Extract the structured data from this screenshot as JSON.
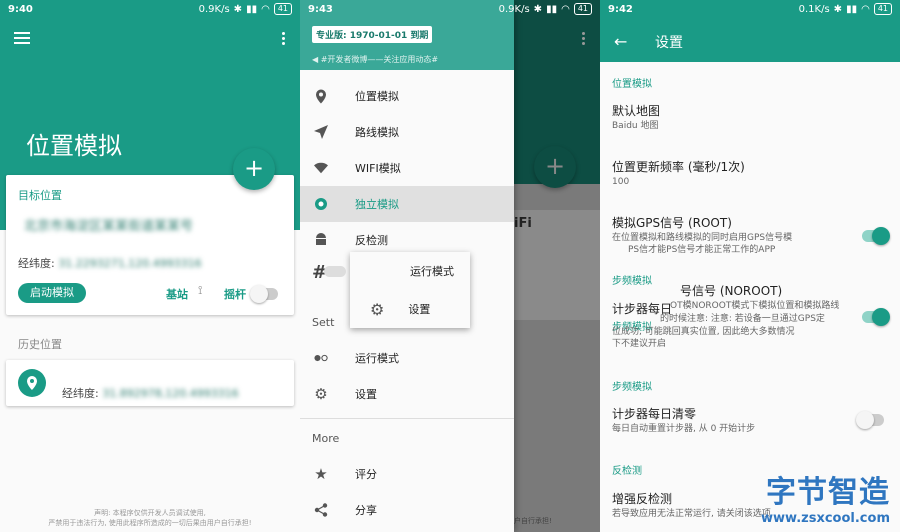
{
  "screen1": {
    "status": {
      "time": "9:40",
      "net": "0.9K/s",
      "battery": "41"
    },
    "title": "位置模拟",
    "fab": "+",
    "target_card": {
      "label": "目标位置",
      "address_blurred": "北京市海淀区某某街道某某号",
      "coords_label": "经纬度:",
      "coords_blurred": "31.2293271,120.4993316",
      "start_button": "启动模拟",
      "base_station": "基站",
      "joystick": "摇杆"
    },
    "history_label": "历史位置",
    "history_card": {
      "coords_label": "经纬度:",
      "coords_blurred": "31.892978,120.4993316"
    },
    "disclaimer_line1": "声明: 本程序仅供开发人员调试使用,",
    "disclaimer_line2": "严禁用于违法行为, 使用此程序所造成的一切后果由用户自行承担!"
  },
  "screen2": {
    "status": {
      "time": "9:43",
      "net": "0.9K/s",
      "battery": "41"
    },
    "pro_badge": "专业版: 1970-01-01 到期",
    "notice": "#开发者微博——关注应用动态#",
    "menu": [
      {
        "label": "位置模拟",
        "icon": "location-pin-icon"
      },
      {
        "label": "路线模拟",
        "icon": "navigation-arrow-icon"
      },
      {
        "label": "WIFI模拟",
        "icon": "wifi-icon"
      },
      {
        "label": "独立模拟",
        "icon": "target-icon"
      },
      {
        "label": "反检测",
        "icon": "android-icon"
      }
    ],
    "hash_text": "#",
    "settings_section": "Sett",
    "settings_items": [
      {
        "label": "运行模式",
        "icon": "toggle-icon"
      },
      {
        "label": "设置",
        "icon": "gear-icon"
      }
    ],
    "popup_items": [
      {
        "label": "运行模式"
      },
      {
        "label": "设置"
      }
    ],
    "more_section": "More",
    "more_items": [
      {
        "label": "评分",
        "icon": "star-icon"
      },
      {
        "label": "分享",
        "icon": "share-icon"
      }
    ],
    "bg_wifi_text": "iFi",
    "bg_footer": "户自行承担!"
  },
  "screen3": {
    "status": {
      "time": "9:42",
      "net": "0.1K/s",
      "battery": "41"
    },
    "title": "设置",
    "sections": {
      "location": "位置模拟",
      "step1": "步频模拟",
      "step2": "步频模拟",
      "step3": "步频模拟",
      "anti": "反检测"
    },
    "prefs": {
      "default_map_title": "默认地图",
      "default_map_value": "Baidu 地图",
      "update_rate_title": "位置更新频率 (毫秒/1次)",
      "update_rate_value": "100",
      "gps_root_title": "模拟GPS信号 (ROOT)",
      "gps_root_sum1": "在位置模拟和路线模拟的同时启用GPS信号模",
      "gps_root_sum2": "PS信才能PS信号才能正常工作的APP",
      "noroot_title": "号信号 (NOROOT)",
      "noroot_title_overlap": "计步器每日",
      "noroot_sum1": "OT模NOROOT模式下模拟位置和模拟路线",
      "noroot_sum2": "的时候注意: 注意: 若设备一旦通过GPS定",
      "noroot_sum3": "位成功, 可能跳回真实位置, 因此绝大多数情况",
      "noroot_sum4": "下不建议开启",
      "step_reset_title": "计步器每日清零",
      "step_reset_sum": "每日自动重置计步器, 从 0 开始计步",
      "anti_title": "增强反检测",
      "anti_sum": "若导致应用无法正常运行, 请关闭该选项"
    },
    "toggles": {
      "gps_root": true,
      "noroot": true,
      "step_reset": false
    }
  },
  "watermark": {
    "big": "字节智造",
    "url": "www.zsxcool.com"
  },
  "colors": {
    "primary": "#1a9b86",
    "watermark": "#2f76c0"
  }
}
